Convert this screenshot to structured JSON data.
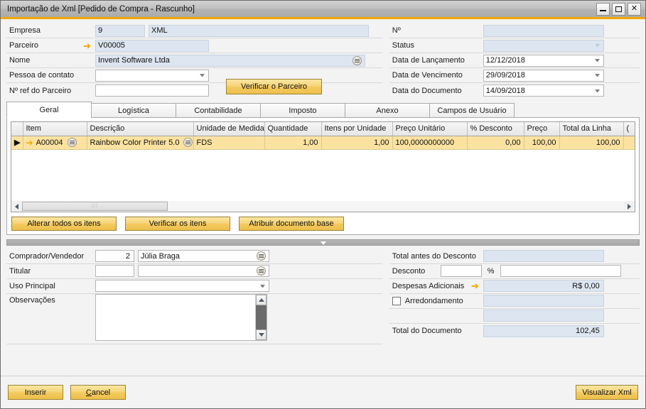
{
  "window": {
    "title": "Importação de Xml [Pedido de Compra - Rascunho]",
    "minimize_label": "minimize",
    "maximize_label": "maximize",
    "close_label": "✕",
    "accent_color": "#f0a800",
    "titlebar_color": "#bfbfbf"
  },
  "header_left": {
    "empresa": {
      "label": "Empresa",
      "code": "9",
      "name": "XML"
    },
    "parceiro": {
      "label": "Parceiro",
      "value": "V00005",
      "link_icon": "arrow-right-link-icon"
    },
    "nome": {
      "label": "Nome",
      "value": "Invent Software Ltda",
      "picker_icon": "list-picker-icon"
    },
    "pessoa_contato": {
      "label": "Pessoa de contato",
      "value": "",
      "dropdown_icon": "chevron-down-icon"
    },
    "ref_parceiro": {
      "label": "Nº ref do Parceiro",
      "value": ""
    },
    "verificar_parceiro_button": "Verificar o Parceiro"
  },
  "header_right": {
    "numero": {
      "label": "Nº",
      "value": ""
    },
    "status": {
      "label": "Status",
      "value": ""
    },
    "data_lancamento": {
      "label": "Data de Lançamento",
      "value": "12/12/2018"
    },
    "data_vencimento": {
      "label": "Data de Vencimento",
      "value": "29/09/2018"
    },
    "data_documento": {
      "label": "Data do Documento",
      "value": "14/09/2018"
    }
  },
  "tabs": [
    {
      "label": "Geral",
      "active": true
    },
    {
      "label": "Logística",
      "active": false
    },
    {
      "label": "Contabilidade",
      "active": false
    },
    {
      "label": "Imposto",
      "active": false
    },
    {
      "label": "Anexo",
      "active": false
    },
    {
      "label": "Campos de Usuário",
      "active": false
    }
  ],
  "grid": {
    "columns": [
      "Item",
      "Descrição",
      "Unidade de Medida",
      "Quantidade",
      "Itens por Unidade",
      "Preço Unitário",
      "% Desconto",
      "Preço",
      "Total da Linha",
      "("
    ],
    "rows": [
      {
        "indicator": "▶",
        "item": "A00004",
        "descricao": "Rainbow Color Printer 5.0",
        "unidade_medida": "FDS",
        "quantidade": "1,00",
        "itens_por_unidade": "1,00",
        "preco_unitario": "100,0000000000",
        "percent_desconto": "0,00",
        "preco": "100,00",
        "total_da_linha": "100,00",
        "extra": ""
      }
    ],
    "scrollbar": {
      "left_icon": "scroll-left-icon",
      "right_icon": "scroll-right-icon",
      "grip": "⁞⁞⁞"
    },
    "buttons": [
      "Alterar todos os itens",
      "Verificar os itens",
      "Atribuir documento base"
    ]
  },
  "bottom_left": {
    "comprador": {
      "label": "Comprador/Vendedor",
      "code": "2",
      "name": "Júlia Braga",
      "picker_icon": "list-picker-icon"
    },
    "titular": {
      "label": "Titular",
      "code": "",
      "name": "",
      "picker_icon": "list-picker-icon"
    },
    "uso_principal": {
      "label": "Uso Principal",
      "value": "",
      "dropdown_icon": "chevron-down-icon"
    },
    "observacoes": {
      "label": "Observações",
      "value": ""
    }
  },
  "bottom_right": {
    "total_antes_desconto": {
      "label": "Total antes do Desconto",
      "value": ""
    },
    "desconto": {
      "label": "Desconto",
      "value": "",
      "unit": "%",
      "amount": ""
    },
    "despesas_adicionais": {
      "label": "Despesas Adicionais",
      "value": "R$ 0,00",
      "link_icon": "arrow-right-link-icon"
    },
    "arredondamento": {
      "label": "Arredondamento",
      "checked": false,
      "value": ""
    },
    "extra_row": {
      "value": ""
    },
    "total_documento": {
      "label": "Total do Documento",
      "value": "102,45"
    }
  },
  "footer": {
    "inserir": "Inserir",
    "cancel_prefix": "C",
    "cancel_rest": "ancel",
    "visualizar_xml": "Visualizar Xml"
  }
}
